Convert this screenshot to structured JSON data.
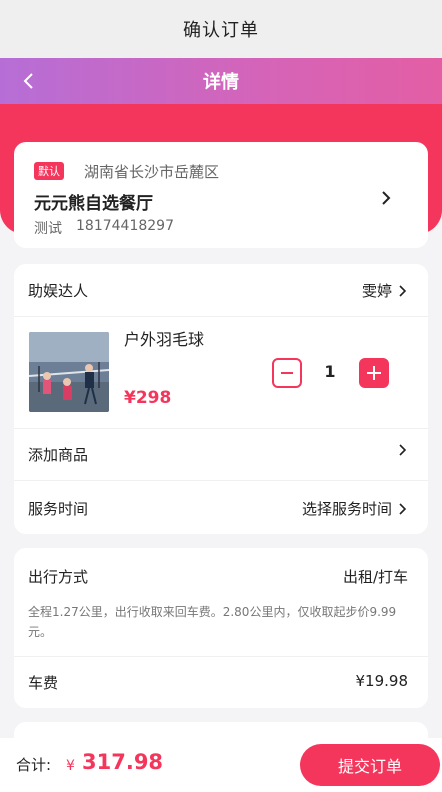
{
  "page": {
    "title": "确认订单"
  },
  "nav": {
    "title": "详情"
  },
  "address": {
    "tag": "默认",
    "region": "湖南省长沙市岳麓区",
    "name": "元元熊自选餐厅",
    "contact_name": "测试",
    "phone": "18174418297"
  },
  "service": {
    "helper_label": "助娱达人",
    "helper_value": "雯婷",
    "product": {
      "name": "户外羽毛球",
      "price": "¥298",
      "quantity": "1"
    },
    "add_product_label": "添加商品",
    "time_label": "服务时间",
    "time_value": "选择服务时间"
  },
  "travel": {
    "mode_label": "出行方式",
    "mode_value": "出租/打车",
    "note": "全程1.27公里，出行收取来回车费。2.80公里内，仅收取起步价9.99元。",
    "fare_label": "车费",
    "fare_value": "¥19.98"
  },
  "footer": {
    "total_label": "合计:",
    "currency": "¥",
    "total_value": "317.98",
    "submit_label": "提交订单"
  },
  "colors": {
    "accent": "#f5365c",
    "nav_start": "#b66ed6",
    "nav_end": "#e35ea4"
  }
}
